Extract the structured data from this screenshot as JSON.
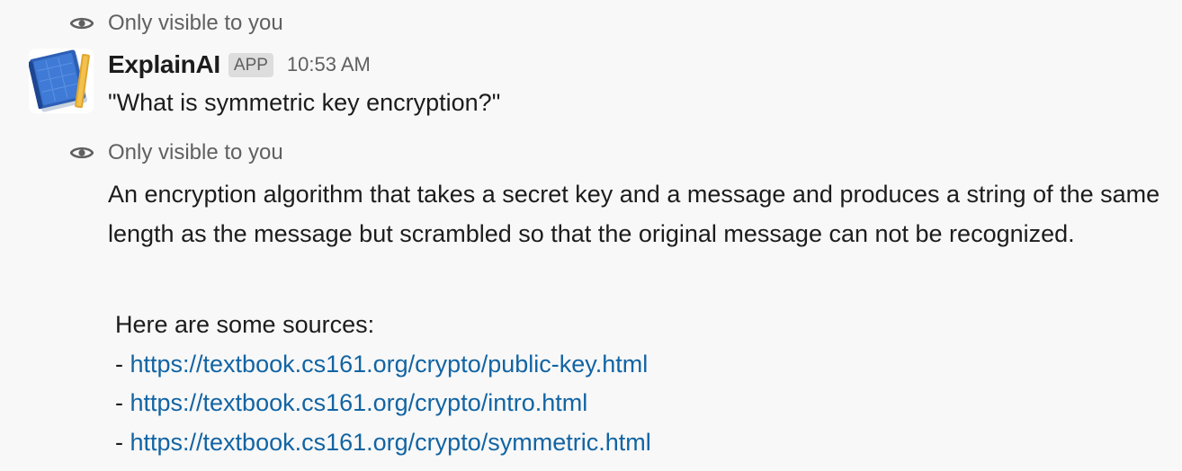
{
  "visibility_notice_1": {
    "icon": "eye-icon",
    "text": "Only visible to you"
  },
  "message": {
    "avatar_icon": "notebook-icon",
    "sender": "ExplainAI",
    "badge": "APP",
    "time": "10:53 AM",
    "question": "\"What is symmetric key encryption?\""
  },
  "visibility_notice_2": {
    "icon": "eye-icon",
    "text": "Only visible to you"
  },
  "answer": {
    "text": "An encryption algorithm that takes a secret key and a message and produces a string of the same length as the message but scrambled so that the original message can not be recognized."
  },
  "sources": {
    "intro": "Here are some sources:",
    "bullet": "- ",
    "links": [
      "https://textbook.cs161.org/crypto/public-key.html",
      "https://textbook.cs161.org/crypto/intro.html",
      "https://textbook.cs161.org/crypto/symmetric.html"
    ]
  },
  "colors": {
    "background": "#f8f8f8",
    "text": "#1d1c1d",
    "muted": "#616061",
    "link": "#1264a3",
    "badge_bg": "#dddddd"
  }
}
